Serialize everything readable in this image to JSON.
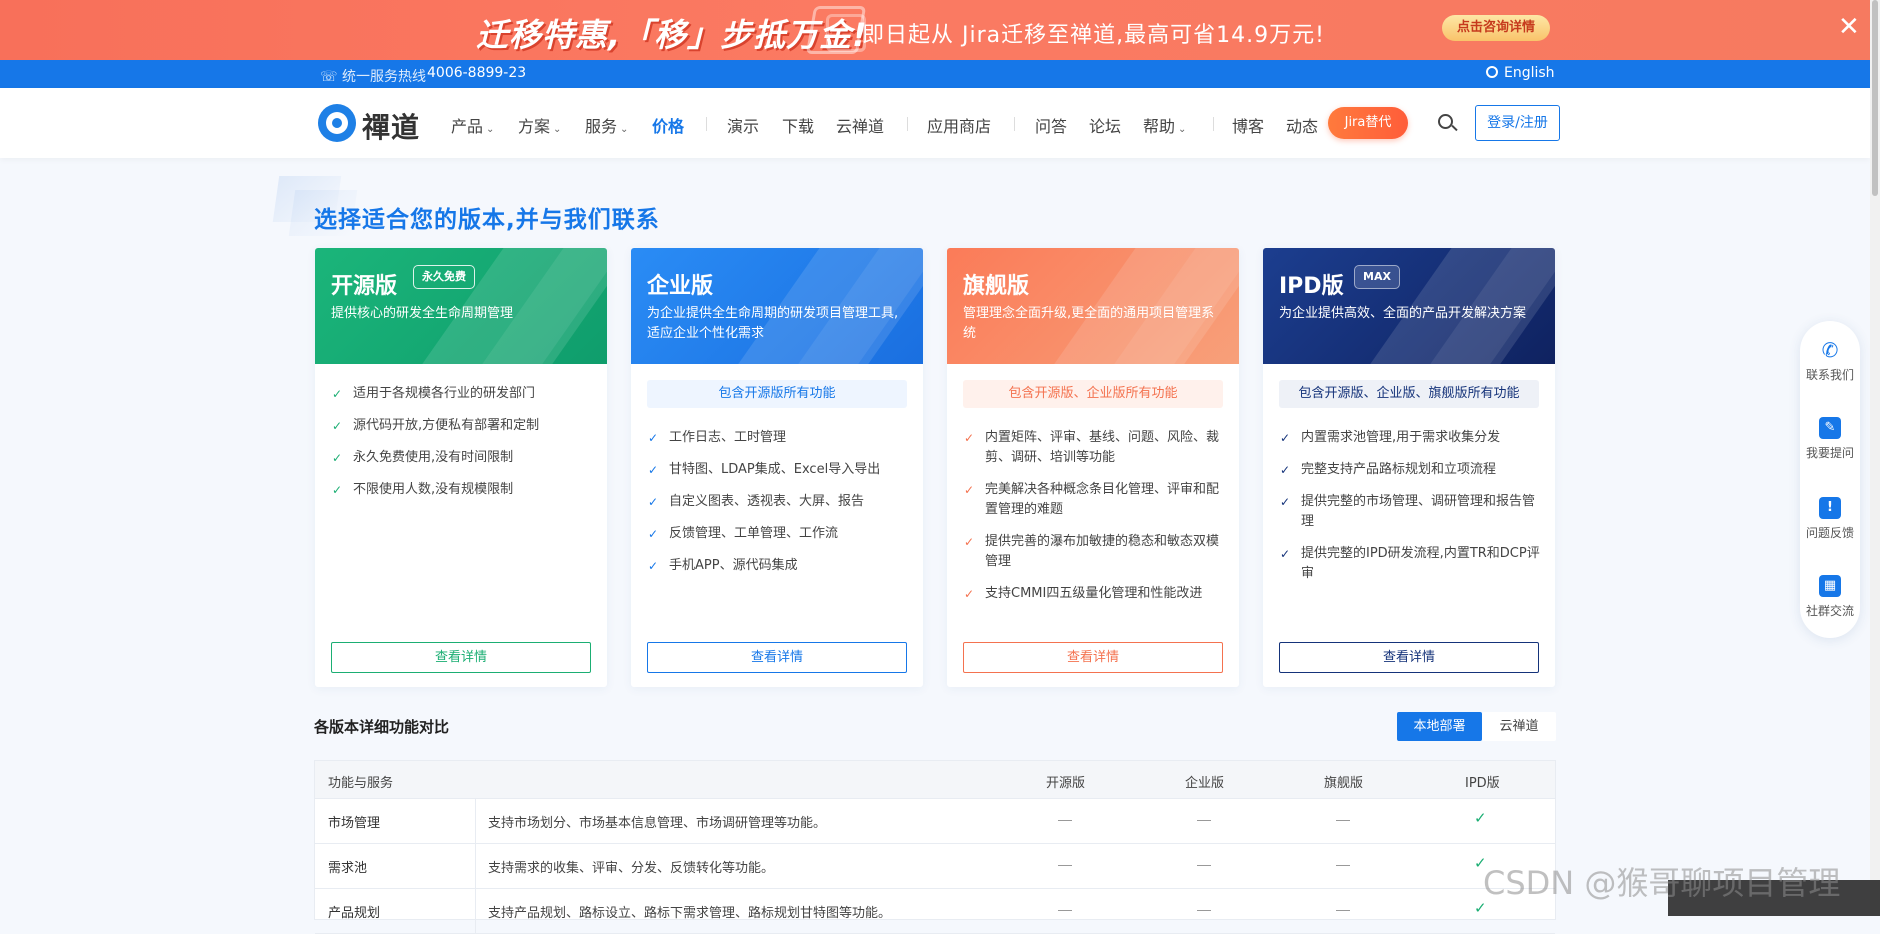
{
  "promo": {
    "headline": "迁移特惠,「移」步抵万金!",
    "subline": "即日起从 Jira迁移至禅道,最高可省14.9万元!",
    "cta": "点击咨询详情",
    "close": "✕"
  },
  "topbar": {
    "hotline_label": "统一服务热线",
    "hotline_number": "4006-8899-23",
    "language": "English"
  },
  "nav": {
    "logo_text": "禪道",
    "items": [
      {
        "label": "产品",
        "has_menu": true
      },
      {
        "label": "方案",
        "has_menu": true
      },
      {
        "label": "服务",
        "has_menu": true
      },
      {
        "label": "价格",
        "active": true
      },
      {
        "label": "演示"
      },
      {
        "label": "下载"
      },
      {
        "label": "云禅道"
      },
      {
        "label": "应用商店"
      },
      {
        "label": "问答"
      },
      {
        "label": "论坛"
      },
      {
        "label": "帮助",
        "has_menu": true
      },
      {
        "label": "博客"
      },
      {
        "label": "动态"
      }
    ],
    "jira_button": "Jira替代",
    "login_button": "登录/注册"
  },
  "heading": "选择适合您的版本,并与我们联系",
  "plans": [
    {
      "title": "开源版",
      "badge": "永久免费",
      "description": "提供核心的研发全生命周期管理",
      "includes": "",
      "features": [
        "适用于各规模各行业的研发部门",
        "源代码开放,方便私有部署和定制",
        "永久免费使用,没有时间限制",
        "不限使用人数,没有规模限制"
      ],
      "button": "查看详情",
      "color": "#1bae73"
    },
    {
      "title": "企业版",
      "badge": "",
      "description": "为企业提供全生命周期的研发项目管理工具,适应企业个性化需求",
      "includes": "包含开源版所有功能",
      "features": [
        "工作日志、工时管理",
        "甘特图、LDAP集成、Excel导入导出",
        "自定义图表、透视表、大屏、报告",
        "反馈管理、工单管理、工作流",
        "手机APP、源代码集成"
      ],
      "button": "查看详情",
      "color": "#1677e8"
    },
    {
      "title": "旗舰版",
      "badge": "",
      "description": "管理理念全面升级,更全面的通用项目管理系统",
      "includes": "包含开源版、企业版所有功能",
      "features": [
        "内置矩阵、评审、基线、问题、风险、裁剪、调研、培训等功能",
        "完美解决各种概念条目化管理、评审和配置管理的难题",
        "提供完善的瀑布加敏捷的稳态和敏态双模管理",
        "支持CMMI四五级量化管理和性能改进"
      ],
      "button": "查看详情",
      "color": "#f4724f"
    },
    {
      "title": "IPD版",
      "badge": "MAX",
      "description": "为企业提供高效、全面的产品开发解决方案",
      "includes": "包含开源版、企业版、旗舰版所有功能",
      "features": [
        "内置需求池管理,用于需求收集分发",
        "完整支持产品路标规划和立项流程",
        "提供完整的市场管理、调研管理和报告管理",
        "提供完整的IPD研发流程,内置TR和DCP评审"
      ],
      "button": "查看详情",
      "color": "#15337a"
    }
  ],
  "comparison": {
    "title": "各版本详细功能对比",
    "tabs": [
      "本地部署",
      "云禅道"
    ],
    "headers": [
      "功能与服务",
      "开源版",
      "企业版",
      "旗舰版",
      "IPD版"
    ],
    "rows": [
      {
        "feature": "市场管理",
        "desc": "支持市场划分、市场基本信息管理、市场调研管理等功能。",
        "values": [
          false,
          false,
          false,
          true
        ]
      },
      {
        "feature": "需求池",
        "desc": "支持需求的收集、评审、分发、反馈转化等功能。",
        "values": [
          false,
          false,
          false,
          true
        ]
      },
      {
        "feature": "产品规划",
        "desc": "支持产品规划、路标设立、路标下需求管理、路标规划甘特图等功能。",
        "values": [
          false,
          false,
          false,
          true
        ]
      }
    ]
  },
  "float_menu": [
    "联系我们",
    "我要提问",
    "问题反馈",
    "社群交流"
  ],
  "watermark": "CSDN @猴哥聊项目管理"
}
